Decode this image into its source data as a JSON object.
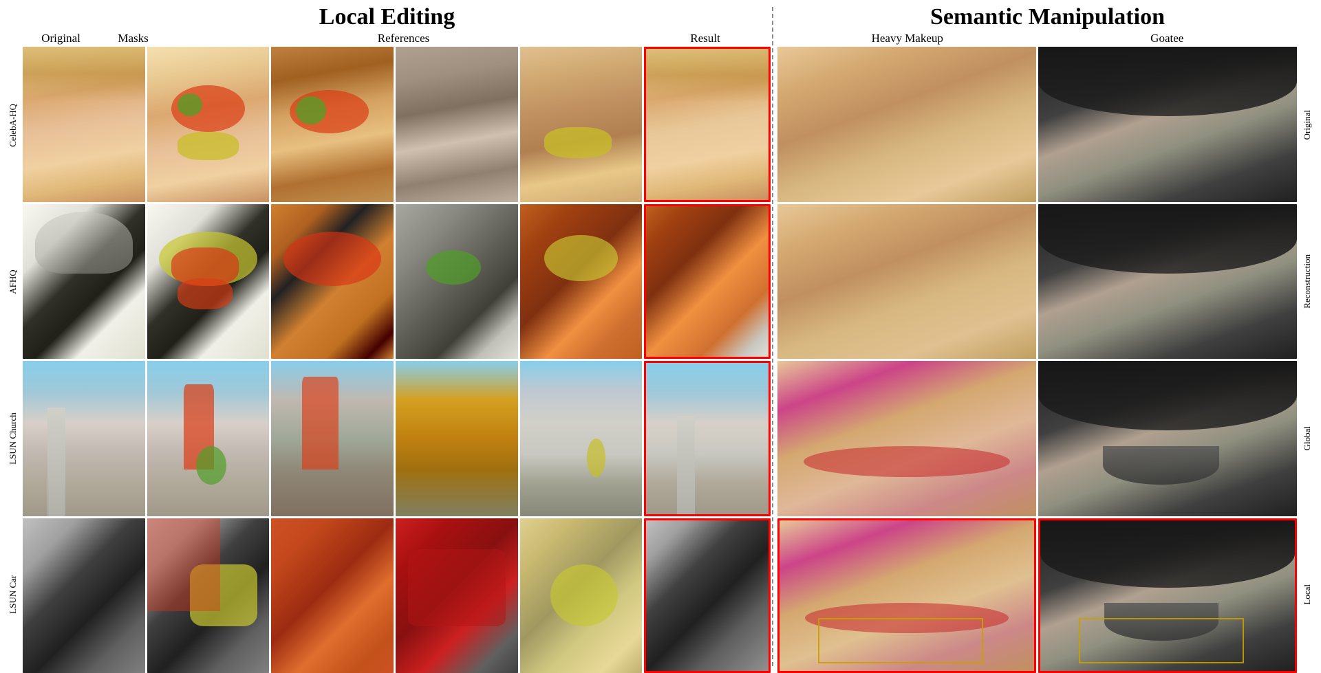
{
  "localEditing": {
    "title": "Local Editing",
    "colHeaders": {
      "original": "Original",
      "masks": "Masks",
      "references": "References",
      "result": "Result"
    },
    "rowLabels": [
      "CelebA-HQ",
      "AFHQ",
      "LSUN Church",
      "LSUN Car"
    ]
  },
  "semanticManipulation": {
    "title": "Semantic Manipulation",
    "colHeaders": {
      "heavyMakeup": "Heavy Makeup",
      "goatee": "Goatee"
    },
    "rowLabels": [
      "Original",
      "Reconstruction",
      "Global",
      "Local"
    ]
  }
}
